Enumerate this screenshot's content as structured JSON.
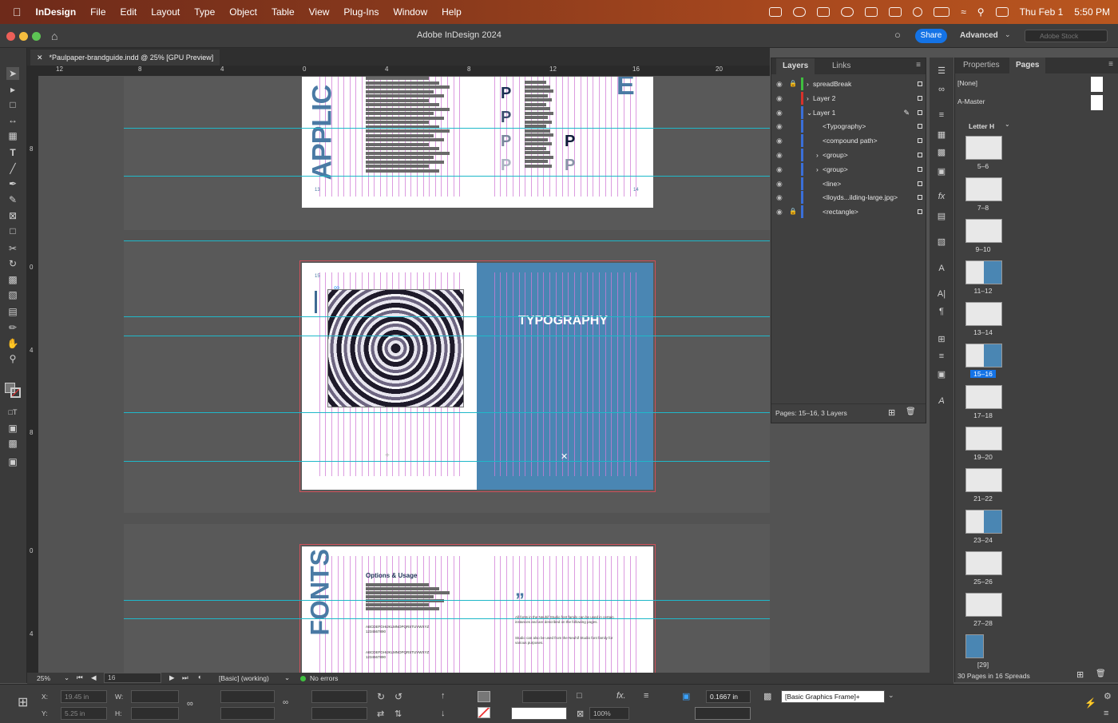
{
  "menubar": {
    "app": "InDesign",
    "items": [
      "File",
      "Edit",
      "Layout",
      "Type",
      "Object",
      "Table",
      "View",
      "Plug-Ins",
      "Window",
      "Help"
    ],
    "date": "Thu Feb 1",
    "time": "5:50 PM"
  },
  "titlebar": {
    "title": "Adobe InDesign 2024",
    "share": "Share",
    "workspace": "Advanced",
    "stock_placeholder": "Adobe Stock"
  },
  "document": {
    "tab": "*Paulpaper-brandguide.indd @ 25% [GPU Preview]"
  },
  "rulers": {
    "h": [
      "12",
      "8",
      "4",
      "0",
      "4",
      "8",
      "12",
      "16",
      "20"
    ],
    "v": [
      "8",
      "0",
      "4",
      "8",
      "0",
      "4"
    ]
  },
  "spreads": {
    "s1": {
      "heading": "APPLIC",
      "left_page": "13",
      "right_page": "14",
      "letter": "P",
      "corner": "E"
    },
    "s2": {
      "page_number": "15",
      "title": "TYPOGRAPHY"
    },
    "s3": {
      "heading": "FONTS",
      "subheading": "Options & Usage",
      "alphabet": "ABCDEFGHIJKLMNOPQRSTUVWXYZ",
      "digits": "1234567890",
      "quote_mark": "”",
      "body1": "All fonts in the Neuhif Studio font family can be used in certain instances and are described on the following pages.",
      "body2": "Studio can also be used from the Neuhif Studio font family for various purposes."
    }
  },
  "layers_panel": {
    "tabs": [
      "Layers",
      "Links"
    ],
    "rows": [
      {
        "name": "spreadBreak",
        "color": "#3fbf3f",
        "lock": true,
        "arrow": "›"
      },
      {
        "name": "Layer 2",
        "color": "#d8322b",
        "lock": false,
        "arrow": "›"
      },
      {
        "name": "Layer 1",
        "color": "#3a6fd8",
        "lock": false,
        "arrow": "⌄"
      },
      {
        "name": "<Typography>",
        "color": "#3a6fd8",
        "lock": false,
        "arrow": ""
      },
      {
        "name": "<compound path>",
        "color": "#3a6fd8",
        "lock": false,
        "arrow": ""
      },
      {
        "name": "<group>",
        "color": "#3a6fd8",
        "lock": false,
        "arrow": "›"
      },
      {
        "name": "<group>",
        "color": "#3a6fd8",
        "lock": false,
        "arrow": "›"
      },
      {
        "name": "<line>",
        "color": "#3a6fd8",
        "lock": false,
        "arrow": ""
      },
      {
        "name": "<lloyds...ilding-large.jpg>",
        "color": "#3a6fd8",
        "lock": false,
        "arrow": ""
      },
      {
        "name": "<rectangle>",
        "color": "#3a6fd8",
        "lock": true,
        "arrow": ""
      }
    ],
    "footer": "Pages: 15–16, 3 Layers"
  },
  "pages_panel": {
    "tabs": [
      "Properties",
      "Pages"
    ],
    "masters": [
      "[None]",
      "A-Master"
    ],
    "size": "Letter H",
    "spreads": [
      "5–6",
      "7–8",
      "9–10",
      "11–12",
      "13–14",
      "15–16",
      "17–18",
      "19–20",
      "21–22",
      "23–24",
      "25–26",
      "27–28",
      "[29]"
    ],
    "footer": "30 Pages in 16 Spreads"
  },
  "status": {
    "zoom": "25%",
    "page": "16",
    "style": "[Basic] (working)",
    "errors": "No errors"
  },
  "control": {
    "x_label": "X:",
    "y_label": "Y:",
    "w_label": "W:",
    "h_label": "H:",
    "x": "19.45 in",
    "y": "5.25 in",
    "pct": "100%",
    "stroke": "0.1667 in",
    "frame_style": "[Basic Graphics Frame]+"
  }
}
